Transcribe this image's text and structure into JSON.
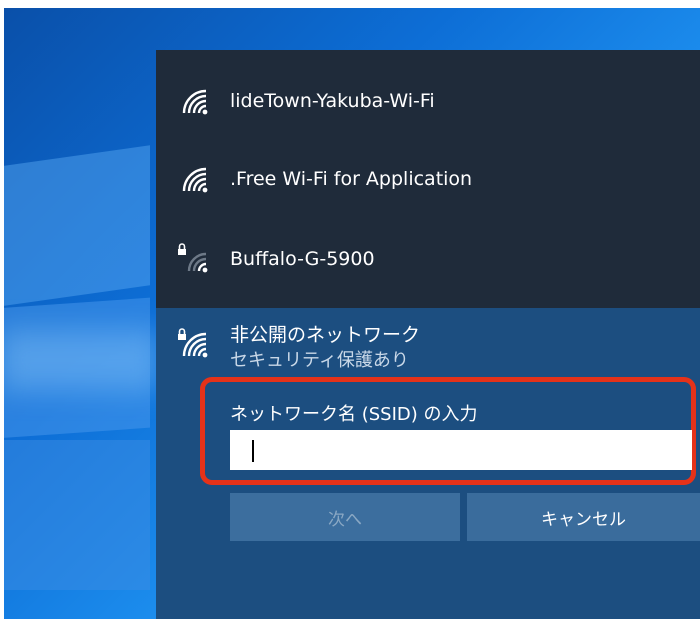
{
  "networks": [
    {
      "name": "lideTown-Yakuba-Wi-Fi",
      "secured": false
    },
    {
      "name": ".Free Wi-Fi for Application",
      "secured": false
    },
    {
      "name": "Buffalo-G-5900",
      "secured": true
    }
  ],
  "hidden_network": {
    "title": "非公開のネットワーク",
    "subtitle": "セキュリティ保護あり",
    "ssid_label": "ネットワーク名 (SSID) の入力",
    "ssid_value": "",
    "next_label": "次へ",
    "cancel_label": "キャンセル"
  },
  "colors": {
    "flyout_bg": "#1f2b3a",
    "expanded_bg": "#1c4e80",
    "highlight": "#e53219"
  },
  "icons": {
    "wifi": "wifi-signal-icon",
    "lock": "lock-icon"
  }
}
